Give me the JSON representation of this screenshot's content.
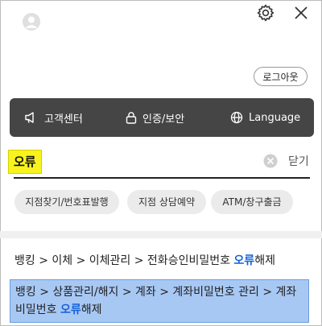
{
  "header": {
    "avatar_icon": "user-avatar-icon",
    "settings_icon": "gear-icon",
    "close_icon": "close-icon"
  },
  "logout_label": "로그아웃",
  "menu": [
    {
      "icon": "megaphone-icon",
      "label": "고객센터"
    },
    {
      "icon": "lock-icon",
      "label": "인증/보안"
    },
    {
      "icon": "globe-icon",
      "label": "Language"
    }
  ],
  "search": {
    "term": "오류",
    "clear_icon": "clear-icon",
    "close_label": "닫기"
  },
  "chips": [
    "지점찾기/번호표발행",
    "지점 상담예약",
    "ATM/창구출금"
  ],
  "results": [
    {
      "prefix": "뱅킹 > 이체 > 이체관리 > 전화승인비밀번호 ",
      "highlight": "오류",
      "suffix": "해제"
    },
    {
      "prefix": "뱅킹 > 상품관리/해지 > 계좌 > 계좌비밀번호 관리 > 계좌비밀번호 ",
      "highlight": "오류",
      "suffix": "해제"
    }
  ],
  "colors": {
    "highlight": "#1560d8",
    "search_term_bg": "#f8f31e",
    "menu_bar_bg": "#454545",
    "selected_result_bg": "#a8c8f4"
  }
}
